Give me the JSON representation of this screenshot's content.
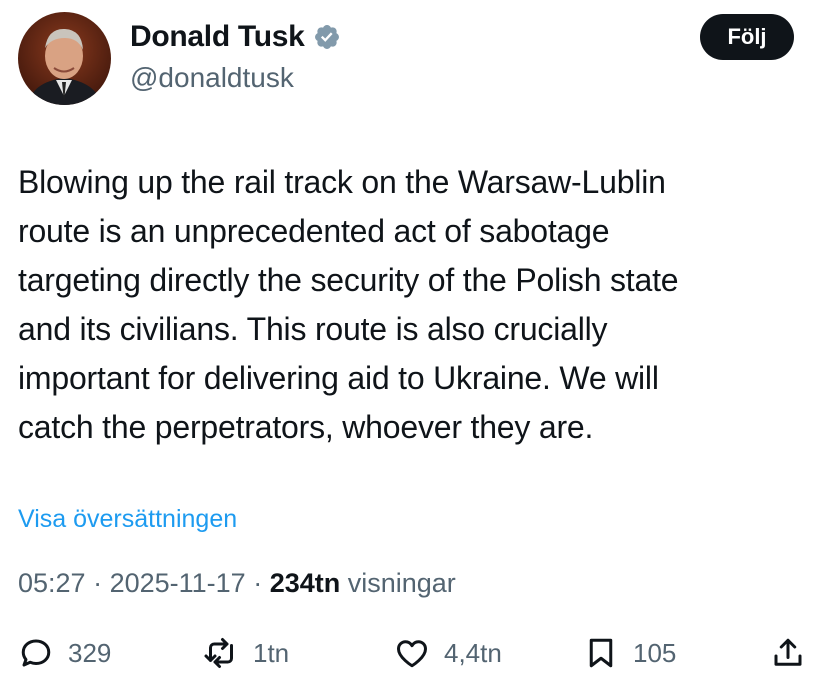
{
  "author": {
    "name": "Donald Tusk",
    "handle": "@donaldtusk",
    "verified_icon": "verified-badge-icon",
    "badge_color": "#829aab"
  },
  "follow_button": {
    "label": "Följ"
  },
  "tweet": {
    "lines": [
      "Blowing up the rail track on the Warsaw-Lublin",
      "route is an unprecedented act of sabotage",
      "targeting directly the security of the Polish state",
      "and its civilians. This route is also crucially",
      "important for delivering aid to Ukraine. We will",
      "catch the perpetrators, whoever they are."
    ]
  },
  "translate_link": "Visa översättningen",
  "meta": {
    "time": "05:27",
    "separator": " · ",
    "date": "2025-11-17",
    "views_count": "234tn",
    "views_label": " visningar"
  },
  "actions": {
    "replies": "329",
    "reposts": "1tn",
    "likes": "4,4tn",
    "bookmarks": "105"
  },
  "colors": {
    "text": "#0f1419",
    "secondary": "#536471",
    "link": "#1d9bf0",
    "follow_bg": "#0f1419"
  }
}
